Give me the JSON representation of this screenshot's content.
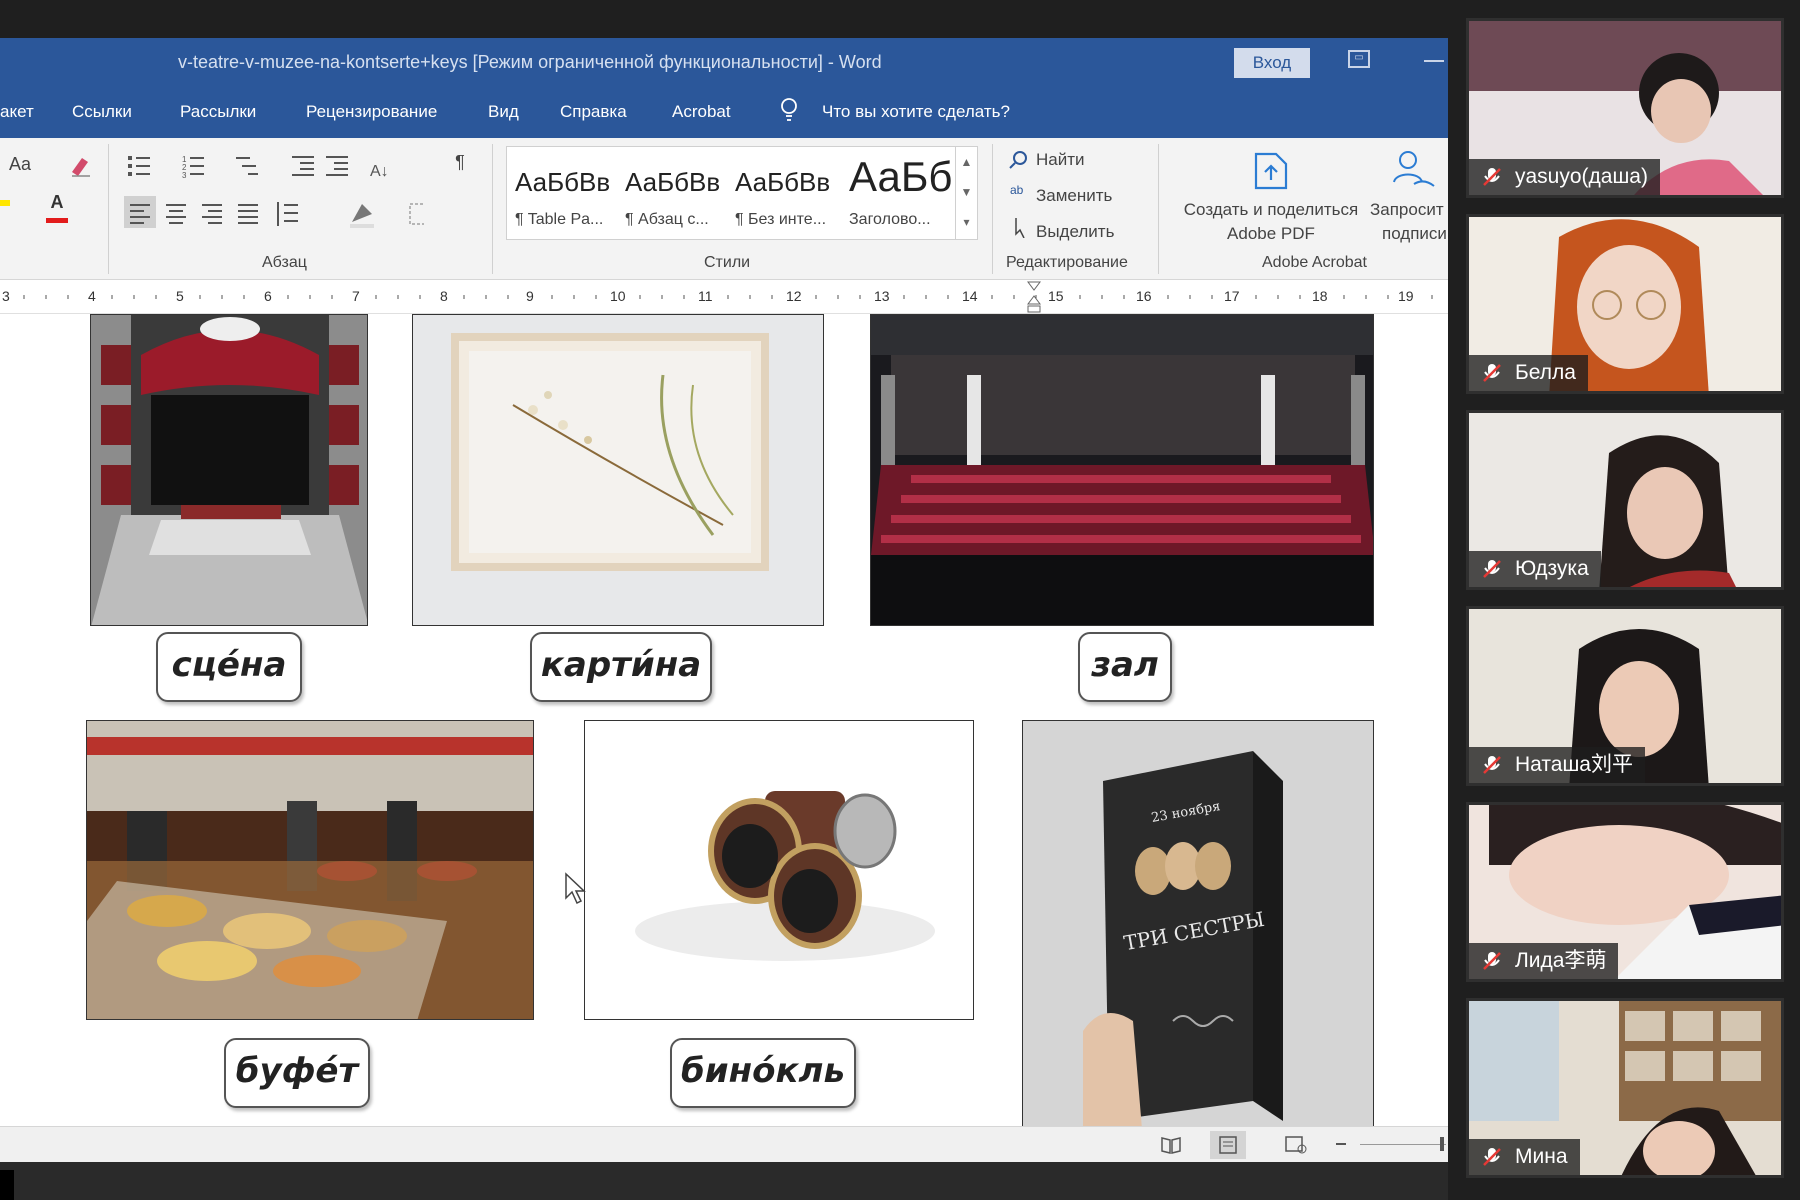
{
  "word": {
    "title": "v-teatre-v-muzee-na-kontserte+keys [Режим ограниченной функциональности]  -  Word",
    "signin_label": "Вход",
    "menu": [
      "акет",
      "Ссылки",
      "Рассылки",
      "Рецензирование",
      "Вид",
      "Справка",
      "Acrobat"
    ],
    "tell_me": "Что вы хотите сделать?",
    "ribbon": {
      "font_case_label": "Aa",
      "font_color_label": "A",
      "paragraph_mark": "¶",
      "paragraph_group": "Абзац",
      "styles_group": "Стили",
      "styles": [
        {
          "preview": "АаБбВв",
          "name": "¶ Table Pa..."
        },
        {
          "preview": "АаБбВв",
          "name": "¶ Абзац с..."
        },
        {
          "preview": "АаБбВв",
          "name": "¶ Без инте..."
        },
        {
          "preview": "АаБб",
          "name": "Заголово..."
        }
      ],
      "find": "Найти",
      "replace": "Заменить",
      "select": "Выделить",
      "editing_group": "Редактирование",
      "acrobat_create_line1": "Создать и поделиться",
      "acrobat_create_line2": "Adobe PDF",
      "acrobat_request_line1": "Запросит",
      "acrobat_request_line2": "подписи",
      "acrobat_group": "Adobe Acrobat"
    },
    "ruler_numbers": [
      "3",
      "4",
      "5",
      "6",
      "7",
      "8",
      "9",
      "10",
      "11",
      "12",
      "13",
      "14",
      "15",
      "16",
      "17",
      "18",
      "19"
    ],
    "cards": [
      {
        "word": "сце́на"
      },
      {
        "word": "карти́на"
      },
      {
        "word": "зал"
      },
      {
        "word": "буфе́т"
      },
      {
        "word": "бино́кль"
      }
    ],
    "program": {
      "date": "23 ноября",
      "title": "ТРИ СЕСТРЫ"
    }
  },
  "participants": [
    {
      "name": "yasuyo(даша)"
    },
    {
      "name": "Белла"
    },
    {
      "name": "Юдзука"
    },
    {
      "name": "Наташа刘平"
    },
    {
      "name": "Лида李萌"
    },
    {
      "name": "Мина"
    }
  ],
  "colors": {
    "word_blue": "#2b579a",
    "muted_mic": "#ffffff"
  }
}
